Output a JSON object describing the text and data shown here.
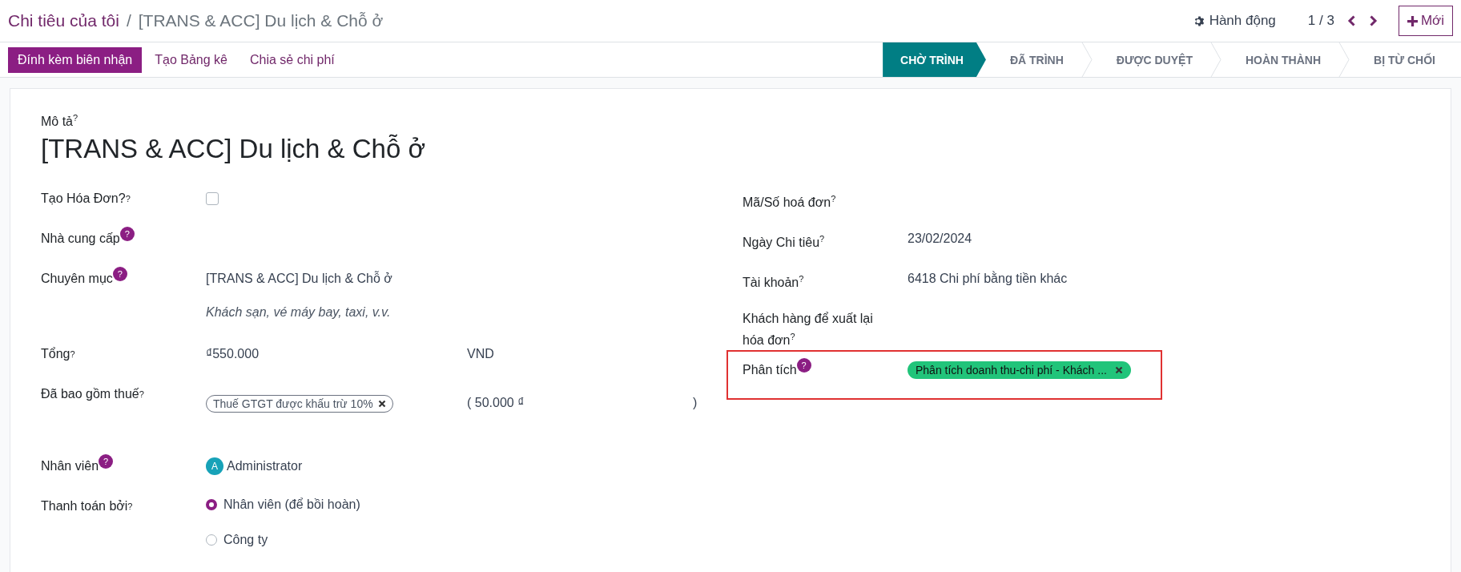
{
  "breadcrumb": {
    "parent": "Chi tiêu của tôi",
    "separator": "/",
    "current": "[TRANS & ACC] Du lịch & Chỗ ở"
  },
  "actions_menu": {
    "label": "Hành động"
  },
  "pager": {
    "text": "1 / 3"
  },
  "new_button": {
    "label": "Mới"
  },
  "toolbar_buttons": [
    {
      "label": "Đính kèm biên nhận",
      "kind": "primary"
    },
    {
      "label": "Tạo Bảng kê",
      "kind": "link"
    },
    {
      "label": "Chia sẻ chi phí",
      "kind": "link"
    }
  ],
  "stages": [
    {
      "label": "CHỜ TRÌNH",
      "selected": true
    },
    {
      "label": "ĐÃ TRÌNH",
      "selected": false
    },
    {
      "label": "ĐƯỢC DUYỆT",
      "selected": false
    },
    {
      "label": "HOÀN THÀNH",
      "selected": false
    },
    {
      "label": "BỊ TỪ CHỐI",
      "selected": false
    }
  ],
  "form": {
    "description_label": "Mô tả",
    "description_help": "?",
    "title": "[TRANS & ACC] Du lịch & Chỗ ở",
    "left_fields": [
      {
        "kind": "checkbox",
        "label": "Tạo Hóa Đơn?",
        "help": "?",
        "help_badge": false,
        "checked": false
      },
      {
        "kind": "empty",
        "label": "Nhà cung cấp",
        "help": "?",
        "help_badge": true
      },
      {
        "kind": "category",
        "label": "Chuyên mục",
        "help": "?",
        "help_badge": true,
        "value": "[TRANS & ACC] Du lịch & Chỗ ở",
        "note": "Khách sạn, vé máy bay, taxi, v.v."
      },
      {
        "kind": "amount",
        "label": "Tổng",
        "help": "?",
        "help_badge": false,
        "value": "₫550.000",
        "currency": "VND"
      },
      {
        "kind": "tax",
        "label": "Đã bao gồm thuế",
        "help": "?",
        "help_badge": false,
        "tag": "Thuế GTGT được khấu trừ 10%",
        "amount": "( 50.000 ₫",
        "close": ")"
      },
      {
        "kind": "user",
        "label": "Nhân viên",
        "help": "?",
        "help_badge": true,
        "initial": "A",
        "value": "Administrator"
      },
      {
        "kind": "radio",
        "label": "Thanh toán bởi",
        "help": "?",
        "help_badge": false,
        "options": [
          {
            "label": "Nhân viên (để bồi hoàn)",
            "selected": true
          },
          {
            "label": "Công ty",
            "selected": false
          }
        ]
      }
    ],
    "right_fields": [
      {
        "kind": "empty",
        "label": "Mã/Số hoá đơn",
        "help": "?",
        "help_badge": false,
        "highlighted": false
      },
      {
        "kind": "text",
        "label": "Ngày Chi tiêu",
        "help": "?",
        "help_badge": false,
        "value": "23/02/2024",
        "highlighted": false
      },
      {
        "kind": "text",
        "label": "Tài khoản",
        "help": "?",
        "help_badge": false,
        "value": "6418 Chi phí bằng tiền khác",
        "highlighted": false
      },
      {
        "kind": "empty",
        "label": "Khách hàng để xuất lại hóa đơn",
        "help": "?",
        "help_badge": false,
        "highlighted": false
      },
      {
        "kind": "tag",
        "label": "Phân tích",
        "help": "?",
        "help_badge": true,
        "tag": "Phân tích doanh thu-chi phí - Khách ...",
        "highlighted": true
      }
    ]
  }
}
